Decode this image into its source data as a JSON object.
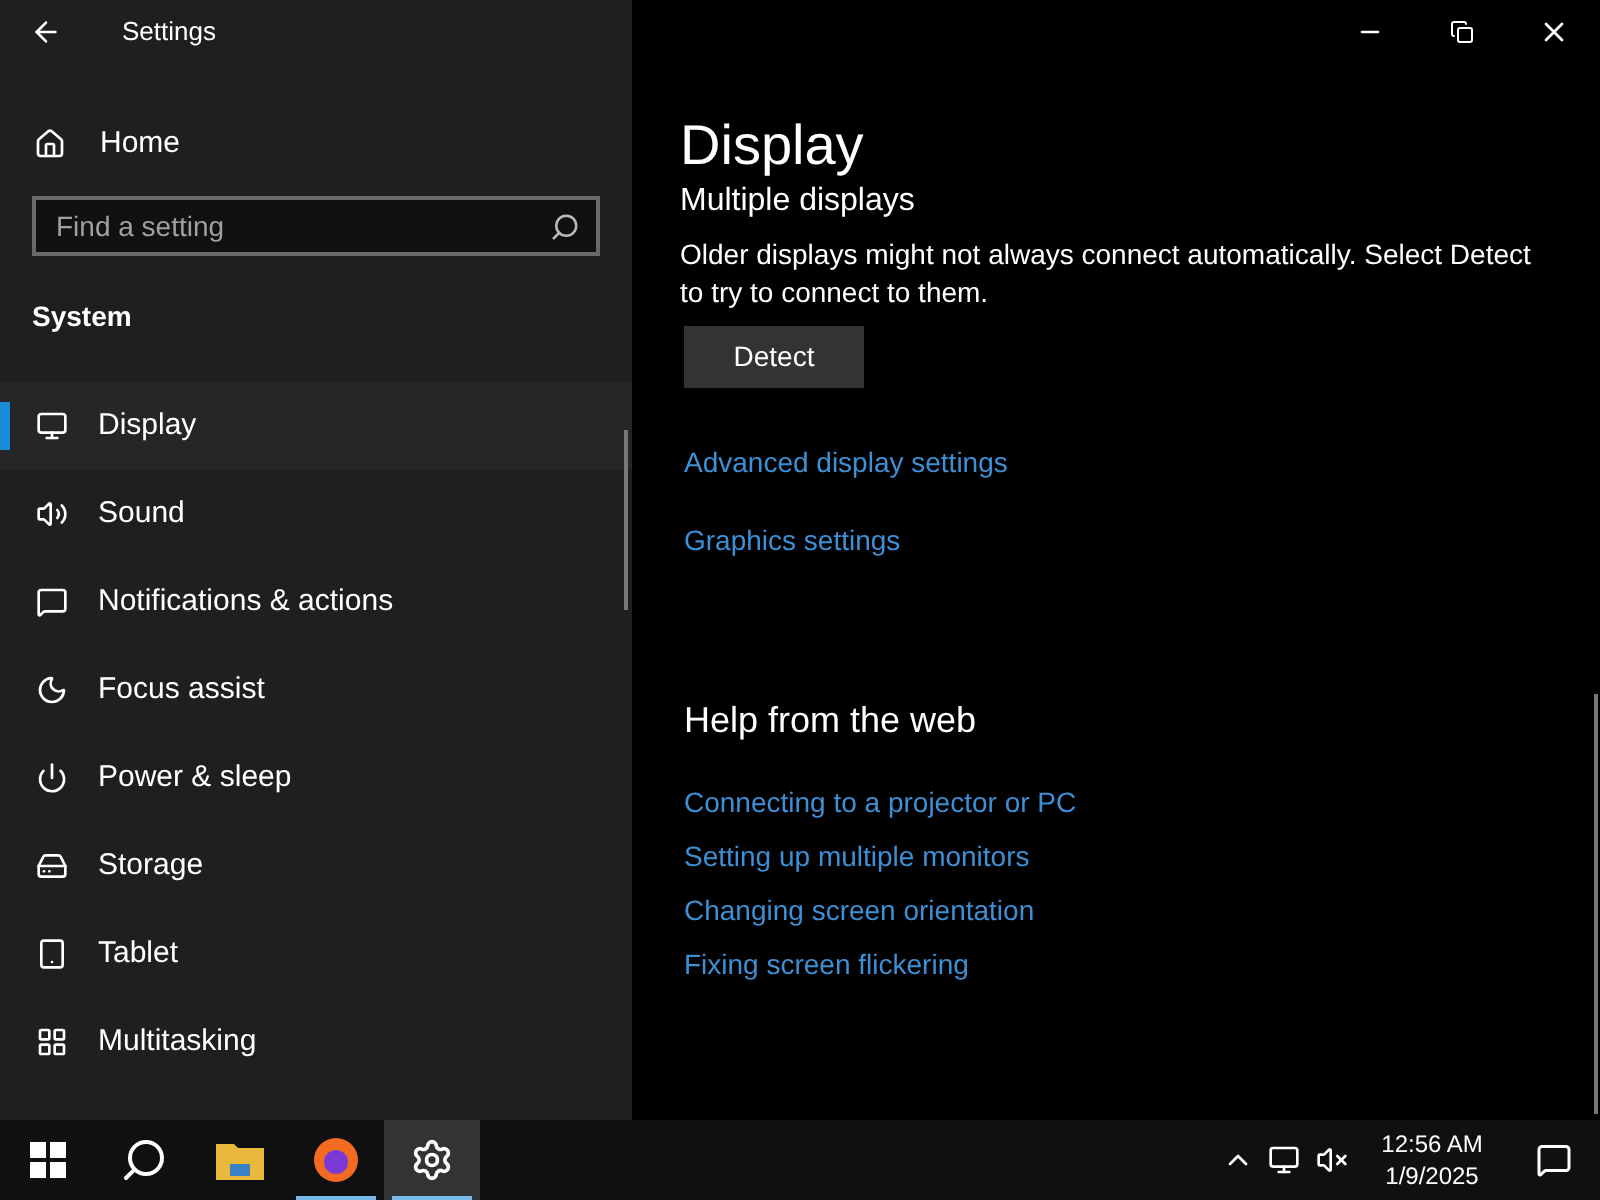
{
  "window": {
    "title": "Settings"
  },
  "sidebar": {
    "home": "Home",
    "search": {
      "placeholder": "Find a setting"
    },
    "section": "System",
    "items": [
      {
        "label": "Display",
        "selected": true
      },
      {
        "label": "Sound",
        "selected": false
      },
      {
        "label": "Notifications & actions",
        "selected": false
      },
      {
        "label": "Focus assist",
        "selected": false
      },
      {
        "label": "Power & sleep",
        "selected": false
      },
      {
        "label": "Storage",
        "selected": false
      },
      {
        "label": "Tablet",
        "selected": false
      },
      {
        "label": "Multitasking",
        "selected": false
      }
    ]
  },
  "content": {
    "title": "Display",
    "section_heading": "Multiple displays",
    "description": "Older displays might not always connect automatically. Select Detect to try to connect to them.",
    "detect_button": "Detect",
    "links": [
      "Advanced display settings",
      "Graphics settings"
    ],
    "help_heading": "Help from the web",
    "help_links": [
      "Connecting to a projector or PC",
      "Setting up multiple monitors",
      "Changing screen orientation",
      "Fixing screen flickering"
    ]
  },
  "taskbar": {
    "apps": [
      {
        "kind": "start",
        "running": false,
        "selected": false
      },
      {
        "kind": "search",
        "running": false,
        "selected": false
      },
      {
        "kind": "explorer",
        "running": false,
        "selected": false
      },
      {
        "kind": "firefox",
        "running": true,
        "selected": false
      },
      {
        "kind": "settings",
        "running": true,
        "selected": true
      }
    ],
    "time": "12:56 AM",
    "date": "1/9/2025"
  }
}
